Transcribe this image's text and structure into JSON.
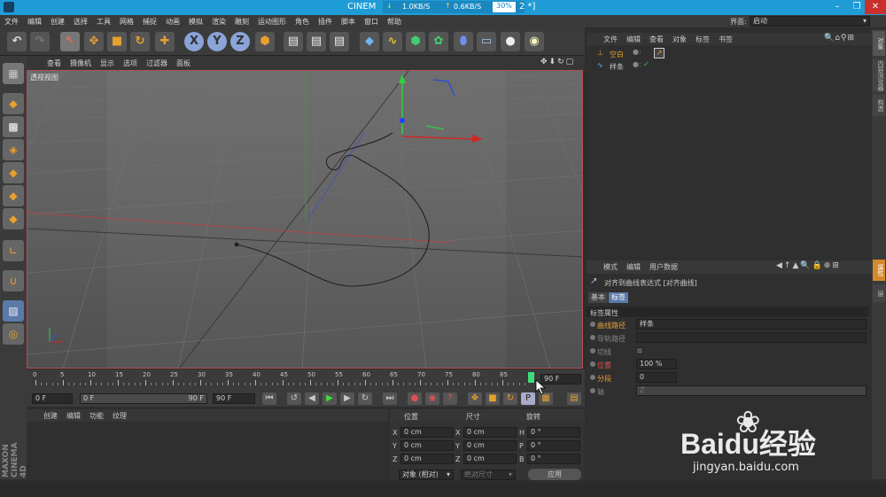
{
  "titlebar": {
    "app_prefix": "CINEM",
    "download": "1.0KB/S",
    "upload": "0.6KB/S",
    "percent": "30%",
    "title_suffix": "2 *]"
  },
  "menu": [
    "文件",
    "编辑",
    "创建",
    "选择",
    "工具",
    "网格",
    "捕捉",
    "动画",
    "模拟",
    "渲染",
    "雕刻",
    "运动图形",
    "角色",
    "插件",
    "脚本",
    "窗口",
    "帮助"
  ],
  "interface": {
    "label": "界面:",
    "value": "启动"
  },
  "viewport": {
    "menu": [
      "查看",
      "摄像机",
      "显示",
      "选项",
      "过滤器",
      "面板"
    ],
    "name": "透视视图"
  },
  "timeline": {
    "ticks": [
      "0",
      "5",
      "10",
      "15",
      "20",
      "25",
      "30",
      "35",
      "40",
      "45",
      "50",
      "55",
      "60",
      "65",
      "70",
      "75",
      "80",
      "85"
    ],
    "current_frame": "90 F"
  },
  "transport": {
    "start": "0 F",
    "min": "0 F",
    "max": "90 F",
    "end": "90 F"
  },
  "material_menu": [
    "创建",
    "编辑",
    "功能",
    "纹理"
  ],
  "coords": {
    "headers": [
      "位置",
      "尺寸",
      "旋转"
    ],
    "rows": [
      {
        "axis": "X",
        "pos": "0 cm",
        "saxis": "X",
        "size": "0 cm",
        "raxis": "H",
        "rot": "0 °"
      },
      {
        "axis": "Y",
        "pos": "0 cm",
        "saxis": "Y",
        "size": "0 cm",
        "raxis": "P",
        "rot": "0 °"
      },
      {
        "axis": "Z",
        "pos": "0 cm",
        "saxis": "Z",
        "size": "0 cm",
        "raxis": "B",
        "rot": "0 °"
      }
    ],
    "mode": "对象 (相对)",
    "size_mode": "绝对尺寸",
    "apply": "应用"
  },
  "objects": {
    "menu": [
      "文件",
      "编辑",
      "查看",
      "对象",
      "标签",
      "书签"
    ],
    "items": [
      {
        "name": "空白"
      },
      {
        "name": "样条"
      }
    ]
  },
  "attributes": {
    "menu": [
      "模式",
      "编辑",
      "用户数据"
    ],
    "title": "对齐到曲线表达式 [对齐曲线]",
    "tabs": [
      "基本",
      "标签"
    ],
    "section": "标签属性",
    "rows": [
      {
        "label": "曲线路径",
        "value": "样条"
      },
      {
        "label": "导轨路径",
        "value": ""
      },
      {
        "label": "切线",
        "value": ""
      },
      {
        "label": "位置",
        "value": "100 %"
      },
      {
        "label": "分段",
        "value": "0"
      },
      {
        "label": "轴",
        "value": "Z"
      }
    ]
  },
  "sidebar_tabs": [
    "对象",
    "内容浏览器",
    "构造",
    "属性",
    "层"
  ],
  "brand": "MAXON CINEMA 4D",
  "watermark": {
    "text": "Baidu经验",
    "url": "jingyan.baidu.com"
  }
}
